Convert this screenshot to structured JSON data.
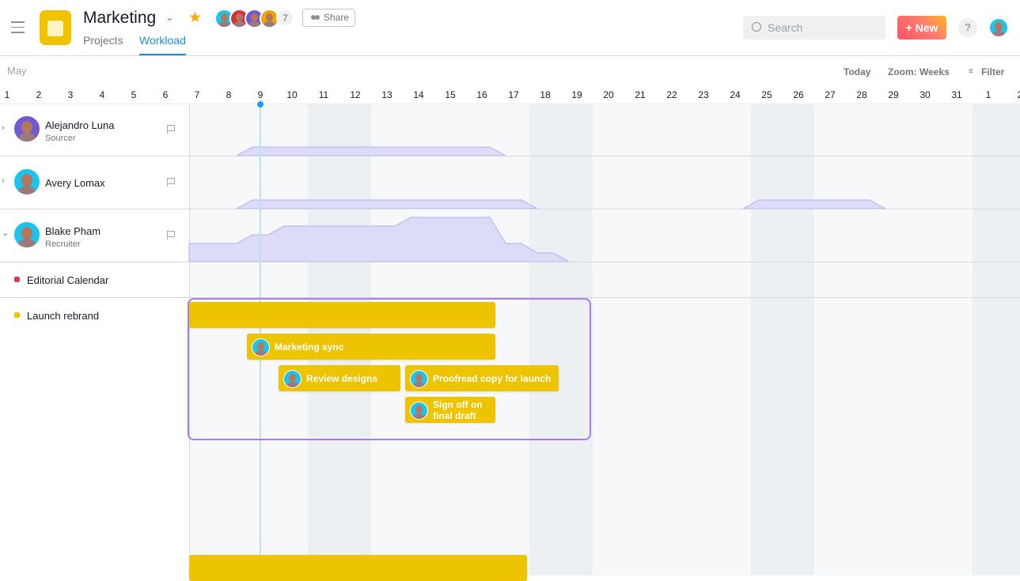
{
  "header": {
    "title": "Marketing",
    "tabs": [
      {
        "label": "Projects"
      },
      {
        "label": "Workload",
        "active": true
      }
    ],
    "member_more": "7",
    "share_label": "Share",
    "search_placeholder": "Search",
    "new_label": "+ New",
    "help_label": "?"
  },
  "colors": {
    "accent": "#1f8dd6",
    "task": "#eec300",
    "workload": "#dcdcf8",
    "selection": "#a77cf6",
    "editorial": "#e8384f",
    "launch": "#f0c300"
  },
  "toolbar": {
    "month": "May",
    "today": "Today",
    "zoom": "Zoom: Weeks",
    "filter": "Filter"
  },
  "days": [
    "1",
    "2",
    "3",
    "4",
    "5",
    "6",
    "7",
    "8",
    "9",
    "10",
    "11",
    "12",
    "13",
    "14",
    "15",
    "16",
    "17",
    "18",
    "19",
    "20",
    "21",
    "22",
    "23",
    "24",
    "25",
    "26",
    "27",
    "28",
    "29",
    "30",
    "31",
    "1",
    "2"
  ],
  "today_day": "9",
  "people": [
    {
      "name": "Alejandro Luna",
      "role": "Sourcer",
      "expanded": false,
      "avatar_color": "#6e5ad6"
    },
    {
      "name": "Avery Lomax",
      "role": "",
      "expanded": false,
      "avatar_color": "#19c5f0"
    },
    {
      "name": "Blake Pham",
      "role": "Recruiter",
      "expanded": true,
      "avatar_color": "#19c5f0"
    }
  ],
  "projects": [
    {
      "name": "Editorial Calendar",
      "color": "#e8384f"
    },
    {
      "name": "Launch rebrand",
      "color": "#f0c300"
    }
  ],
  "tasks": [
    {
      "label": ""
    },
    {
      "label": "Marketing sync"
    },
    {
      "label": "Review designs"
    },
    {
      "label": "Proofread copy for launch"
    },
    {
      "label": "Sign off on final draft"
    },
    {
      "label": ""
    }
  ]
}
